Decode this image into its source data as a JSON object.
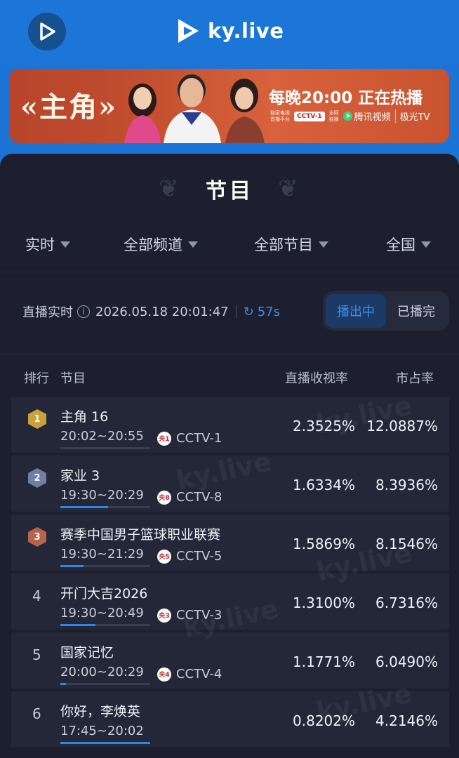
{
  "header": {
    "logo_text": "ky.live"
  },
  "banner": {
    "title": "«主角»",
    "slogan": "每晚20:00 正在热播",
    "platform_note_1": "独家电视",
    "platform_note_2": "首播平台",
    "cctv_badge": "CCTV-1",
    "net_note_1": "全网",
    "net_note_2": "独播",
    "tencent": "腾讯视频",
    "jiguang": "极光TV"
  },
  "panel": {
    "title": "节目",
    "filters": [
      "实时",
      "全部频道",
      "全部节目",
      "全国"
    ],
    "status_label": "直播实时",
    "timestamp": "2026.05.18 20:01:47",
    "countdown": "57s",
    "toggle": {
      "active": "播出中",
      "inactive": "已播完"
    },
    "columns": {
      "rank": "排行",
      "program": "节目",
      "rating": "直播收视率",
      "share": "市占率"
    }
  },
  "colors": {
    "accent": "#3b8ef0",
    "gold": "#c9a23b",
    "silver": "#6f7fa0",
    "bronze": "#b5654a",
    "header_blue": "#1c76d8"
  },
  "rows": [
    {
      "rank": "1",
      "name": "主角 16",
      "time": "20:02~20:55",
      "channel_icon": "央1",
      "channel": "CCTV-1",
      "rating": "2.3525%",
      "share": "12.0887%",
      "progress": 0.0
    },
    {
      "rank": "2",
      "name": "家业 3",
      "time": "19:30~20:29",
      "channel_icon": "央8",
      "channel": "CCTV-8",
      "rating": "1.6334%",
      "share": "8.3936%",
      "progress": 0.53
    },
    {
      "rank": "3",
      "name": "赛季中国男子篮球职业联赛",
      "time": "19:30~21:29",
      "channel_icon": "央5",
      "channel": "CCTV-5",
      "rating": "1.5869%",
      "share": "8.1546%",
      "progress": 0.26
    },
    {
      "rank": "4",
      "name": "开门大吉2026",
      "time": "19:30~20:49",
      "channel_icon": "央3",
      "channel": "CCTV-3",
      "rating": "1.3100%",
      "share": "6.7316%",
      "progress": 0.39
    },
    {
      "rank": "5",
      "name": "国家记忆",
      "time": "20:00~20:29",
      "channel_icon": "央4",
      "channel": "CCTV-4",
      "rating": "1.1771%",
      "share": "6.0490%",
      "progress": 0.06
    },
    {
      "rank": "6",
      "name": "你好，李焕英",
      "time": "17:45~20:02",
      "channel_icon": "",
      "channel": "",
      "rating": "0.8202%",
      "share": "4.2146%",
      "progress": 1.0
    }
  ]
}
